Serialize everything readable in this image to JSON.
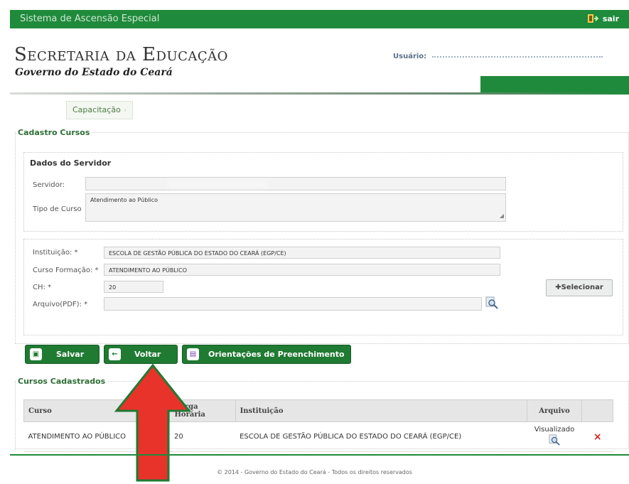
{
  "topbar": {
    "system_title": "Sistema de Ascensão Especial",
    "exit_label": "sair"
  },
  "header": {
    "brand_title": "Secretaria da Educação",
    "brand_subtitle": "Governo do Estado do Ceará",
    "user_label": "Usuário:"
  },
  "menu": {
    "items": [
      {
        "label": "Capacitação"
      }
    ]
  },
  "form": {
    "section_title": "Cadastro Cursos",
    "servidor_panel": {
      "title": "Dados do Servidor",
      "servidor_label": "Servidor:",
      "servidor_value": "",
      "tipo_curso_label": "Tipo de Curso",
      "tipo_curso_value": "Atendimento ao Público"
    },
    "course_panel": {
      "instituicao_label": "Instituição: *",
      "instituicao_value": "ESCOLA DE GESTÃO PÚBLICA DO ESTADO DO CEARÁ (EGP/CE)",
      "curso_label": "Curso Formação: *",
      "curso_value": "ATENDIMENTO AO PÚBLICO",
      "ch_label": "CH: *",
      "ch_value": "20",
      "arquivo_label": "Arquivo(PDF): *",
      "arquivo_value": "",
      "select_button": "Selecionar"
    }
  },
  "actions": {
    "save_label": "Salvar",
    "back_label": "Voltar",
    "guide_label": "Orientações de Preenchimento"
  },
  "list": {
    "section_title": "Cursos Cadastrados",
    "columns": [
      "Curso",
      "Carga Horária",
      "Instituição",
      "Arquivo",
      ""
    ],
    "rows": [
      {
        "curso": "ATENDIMENTO AO PÚBLICO",
        "carga_horaria": "20",
        "instituicao": "ESCOLA DE GESTÃO PÚBLICA DO ESTADO DO CEARÁ (EGP/CE)",
        "arquivo": "Visualizado",
        "delete_icon": "×"
      }
    ]
  },
  "footer": {
    "text": "© 2014 - Governo do Estado do Ceará - Todos os direitos reservados"
  },
  "annotation": {
    "arrow_color": "#e8332a",
    "arrow_outline": "#1f7a32",
    "points_to": "Voltar"
  },
  "colors": {
    "brand_green": "#1f8a3b",
    "button_green": "#1f7a32",
    "delete_red": "#d32020"
  }
}
